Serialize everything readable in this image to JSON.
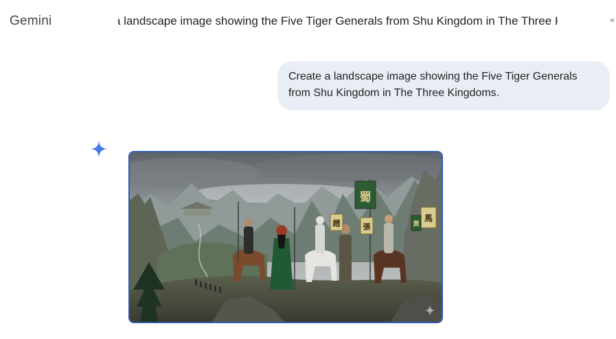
{
  "app": {
    "brand": "Gemini"
  },
  "header": {
    "conversation_title": "a landscape image showing the Five Tiger Generals from Shu Kingdom in The Three Kingdoms",
    "more_glyph": "«"
  },
  "user_message": {
    "text": "Create a landscape image showing the Five Tiger Generals from Shu Kingdom in The Three Kingdoms."
  },
  "response": {
    "banners": [
      "蜀",
      "趙",
      "張",
      "馬",
      "黃"
    ],
    "icon": "gemini-sparkle-icon"
  },
  "colors": {
    "bubble": "#e9eef6",
    "image_border": "#2d5bb5",
    "sparkle": "#4a7ff0"
  }
}
